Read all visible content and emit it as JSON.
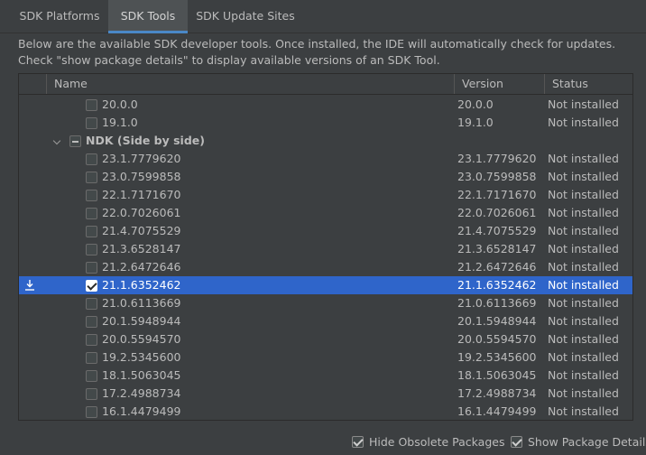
{
  "tabs": [
    {
      "label": "SDK Platforms",
      "active": false
    },
    {
      "label": "SDK Tools",
      "active": true
    },
    {
      "label": "SDK Update Sites",
      "active": false
    }
  ],
  "description": "Below are the available SDK developer tools. Once installed, the IDE will automatically check for updates. Check \"show package details\" to display available versions of an SDK Tool.",
  "table": {
    "columns": [
      "Name",
      "Version",
      "Status"
    ],
    "rows": [
      {
        "type": "item",
        "name": "20.0.0",
        "version": "20.0.0",
        "status": "Not installed",
        "checked": false
      },
      {
        "type": "item",
        "name": "19.1.0",
        "version": "19.1.0",
        "status": "Not installed",
        "checked": false
      },
      {
        "type": "group",
        "name": "NDK (Side by side)",
        "expanded": true,
        "state": "mixed"
      },
      {
        "type": "item",
        "name": "23.1.7779620",
        "version": "23.1.7779620",
        "status": "Not installed",
        "checked": false
      },
      {
        "type": "item",
        "name": "23.0.7599858",
        "version": "23.0.7599858",
        "status": "Not installed",
        "checked": false
      },
      {
        "type": "item",
        "name": "22.1.7171670",
        "version": "22.1.7171670",
        "status": "Not installed",
        "checked": false
      },
      {
        "type": "item",
        "name": "22.0.7026061",
        "version": "22.0.7026061",
        "status": "Not installed",
        "checked": false
      },
      {
        "type": "item",
        "name": "21.4.7075529",
        "version": "21.4.7075529",
        "status": "Not installed",
        "checked": false
      },
      {
        "type": "item",
        "name": "21.3.6528147",
        "version": "21.3.6528147",
        "status": "Not installed",
        "checked": false
      },
      {
        "type": "item",
        "name": "21.2.6472646",
        "version": "21.2.6472646",
        "status": "Not installed",
        "checked": false
      },
      {
        "type": "item",
        "name": "21.1.6352462",
        "version": "21.1.6352462",
        "status": "Not installed",
        "checked": true,
        "selected": true,
        "pending_install": true
      },
      {
        "type": "item",
        "name": "21.0.6113669",
        "version": "21.0.6113669",
        "status": "Not installed",
        "checked": false
      },
      {
        "type": "item",
        "name": "20.1.5948944",
        "version": "20.1.5948944",
        "status": "Not installed",
        "checked": false
      },
      {
        "type": "item",
        "name": "20.0.5594570",
        "version": "20.0.5594570",
        "status": "Not installed",
        "checked": false
      },
      {
        "type": "item",
        "name": "19.2.5345600",
        "version": "19.2.5345600",
        "status": "Not installed",
        "checked": false
      },
      {
        "type": "item",
        "name": "18.1.5063045",
        "version": "18.1.5063045",
        "status": "Not installed",
        "checked": false
      },
      {
        "type": "item",
        "name": "17.2.4988734",
        "version": "17.2.4988734",
        "status": "Not installed",
        "checked": false
      },
      {
        "type": "item",
        "name": "16.1.4479499",
        "version": "16.1.4479499",
        "status": "Not installed",
        "checked": false
      }
    ]
  },
  "options": {
    "hide_obsolete": {
      "label": "Hide Obsolete Packages",
      "checked": true
    },
    "show_details": {
      "label": "Show Package Details",
      "checked": true
    }
  },
  "icons": {
    "pending_install": "download-icon"
  },
  "colors": {
    "selection": "#2f65ca",
    "accent": "#4a88c7",
    "background": "#3c3f41"
  }
}
